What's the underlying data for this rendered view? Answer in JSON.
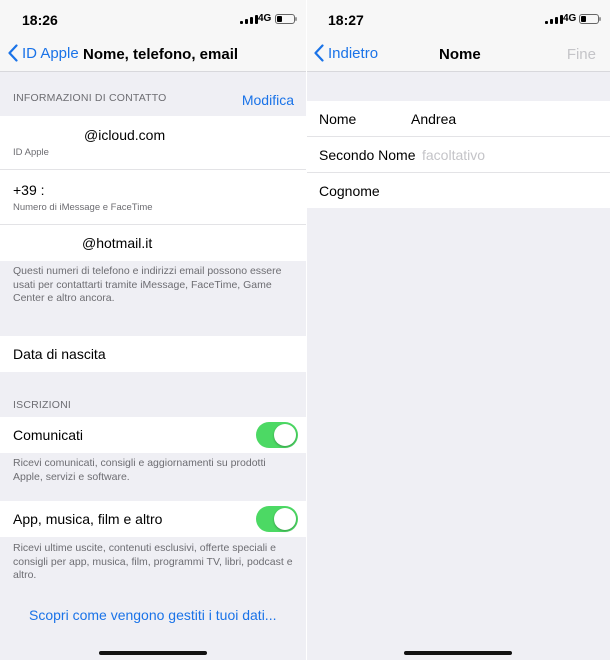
{
  "left": {
    "status": {
      "time": "18:26",
      "network": "4G"
    },
    "nav": {
      "back_label": "ID Apple",
      "title": "Nome, telefono, email"
    },
    "contact": {
      "header": "INFORMAZIONI DI CONTATTO",
      "edit_label": "Modifica",
      "rows": [
        {
          "value": "@icloud.com",
          "sub": "ID Apple"
        },
        {
          "value": "+39 :",
          "sub": "Numero di iMessage e FaceTime"
        },
        {
          "value": "@hotmail.it",
          "sub": ""
        }
      ],
      "footnote": "Questi numeri di telefono e indirizzi email possono essere usati per contattarti tramite iMessage, FaceTime, Game Center e altro ancora."
    },
    "birthday": {
      "label": "Data di nascita"
    },
    "subscriptions": {
      "header": "ISCRIZIONI",
      "items": [
        {
          "label": "Comunicati",
          "enabled": true,
          "footnote": "Ricevi comunicati, consigli e aggiornamenti su prodotti Apple, servizi e software."
        },
        {
          "label": "App, musica, film e altro",
          "enabled": true,
          "footnote": "Ricevi ultime uscite, contenuti esclusivi, offerte speciali e consigli per app, musica, film, programmi TV, libri, podcast e altro."
        }
      ]
    },
    "data_link": "Scopri come vengono gestiti i tuoi dati..."
  },
  "right": {
    "status": {
      "time": "18:27",
      "network": "4G"
    },
    "nav": {
      "back_label": "Indietro",
      "title": "Nome",
      "done_label": "Fine"
    },
    "fields": [
      {
        "label": "Nome",
        "value": "Andrea",
        "placeholder": ""
      },
      {
        "label": "Secondo Nome",
        "value": "",
        "placeholder": "facoltativo"
      },
      {
        "label": "Cognome",
        "value": "",
        "placeholder": ""
      }
    ]
  },
  "colors": {
    "accent": "#1a73e8",
    "toggle_on": "#4cd964",
    "background": "#efeff4"
  }
}
